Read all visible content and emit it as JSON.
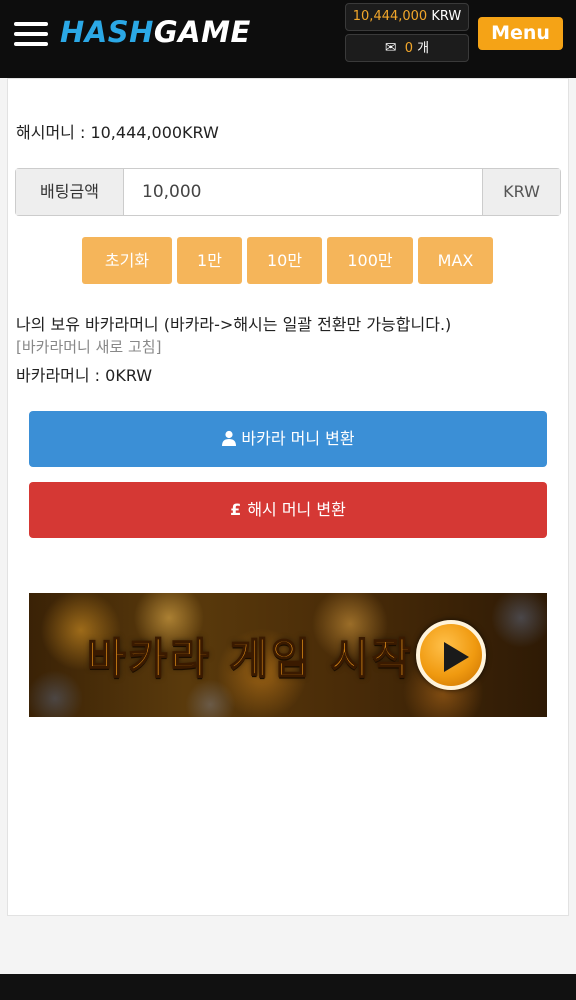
{
  "header": {
    "logo_hash": "HASH",
    "logo_game": "GAME",
    "balance_amount": "10,444,000",
    "balance_currency": "KRW",
    "message_count": "0",
    "message_unit": "개",
    "menu_label": "Menu"
  },
  "main": {
    "hash_money_text": "해시머니 : 10,444,000KRW",
    "bet_label": "배팅금액",
    "bet_value": "10,000",
    "bet_unit": "KRW",
    "amount_buttons": [
      "초기화",
      "1만",
      "10만",
      "100만",
      "MAX"
    ],
    "info_text": "나의 보유 바카라머니 (바카라->해시는 일괄 전환만 가능합니다.)",
    "refresh_link": "[바카라머니 새로 고침]",
    "baccarat_money_text": "바카라머니 : 0KRW",
    "baccarat_convert_label": "바카라 머니 변환",
    "hash_convert_label": "해시 머니 변환",
    "banner_text": "바카라 게임 시작"
  },
  "colors": {
    "header_bg": "#0d0d0d",
    "logo_accent": "#2ba8e6",
    "menu_button": "#f5a316",
    "amount_button": "#f5b55a",
    "baccarat_button": "#3b8fd6",
    "hash_button": "#d53834"
  }
}
